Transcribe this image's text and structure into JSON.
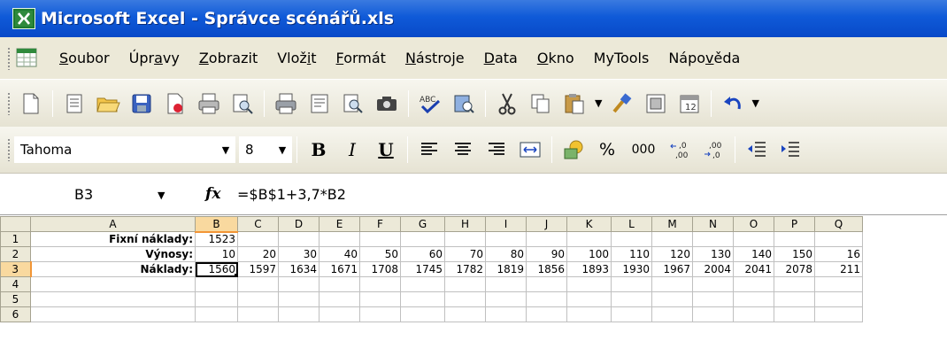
{
  "window": {
    "title": "Microsoft Excel - Správce scénářů.xls"
  },
  "menu": [
    {
      "before": "",
      "u": "S",
      "after": "oubor"
    },
    {
      "before": "Úpr",
      "u": "a",
      "after": "vy"
    },
    {
      "before": "",
      "u": "Z",
      "after": "obrazit"
    },
    {
      "before": "Vlož",
      "u": "i",
      "after": "t"
    },
    {
      "before": "",
      "u": "F",
      "after": "ormát"
    },
    {
      "before": "",
      "u": "N",
      "after": "ástroje"
    },
    {
      "before": "",
      "u": "D",
      "after": "ata"
    },
    {
      "before": "",
      "u": "O",
      "after": "kno"
    },
    {
      "before": "MyTools",
      "u": "",
      "after": ""
    },
    {
      "before": "Nápo",
      "u": "v",
      "after": "ěda"
    }
  ],
  "format_toolbar": {
    "font": "Tahoma",
    "size": "8",
    "bold": "B",
    "italic": "I",
    "underline": "U",
    "percent": "%",
    "thousands": "000",
    "inc_decimal": "⁺⁰,₀₀",
    "dec_decimal": ",₀₀→,₀"
  },
  "formula_bar": {
    "cell_ref": "B3",
    "fx": "fx",
    "formula": "=$B$1+3,7*B2"
  },
  "sheet": {
    "columns": [
      "A",
      "B",
      "C",
      "D",
      "E",
      "F",
      "G",
      "H",
      "I",
      "J",
      "K",
      "L",
      "M",
      "N",
      "O",
      "P",
      "Q"
    ],
    "selected_column": "B",
    "selected_row": "3",
    "rows": [
      {
        "num": "1",
        "label": "Fixní náklady:",
        "cells": [
          "1523",
          "",
          "",
          "",
          "",
          "",
          "",
          "",
          "",
          "",
          "",
          "",
          "",
          "",
          "",
          ""
        ]
      },
      {
        "num": "2",
        "label": "Výnosy:",
        "cells": [
          "10",
          "20",
          "30",
          "40",
          "50",
          "60",
          "70",
          "80",
          "90",
          "100",
          "110",
          "120",
          "130",
          "140",
          "150",
          "16"
        ]
      },
      {
        "num": "3",
        "label": "Náklady:",
        "cells": [
          "1560",
          "1597",
          "1634",
          "1671",
          "1708",
          "1745",
          "1782",
          "1819",
          "1856",
          "1893",
          "1930",
          "1967",
          "2004",
          "2041",
          "2078",
          "211"
        ]
      },
      {
        "num": "4",
        "label": "",
        "cells": [
          "",
          "",
          "",
          "",
          "",
          "",
          "",
          "",
          "",
          "",
          "",
          "",
          "",
          "",
          "",
          ""
        ]
      },
      {
        "num": "5",
        "label": "",
        "cells": [
          "",
          "",
          "",
          "",
          "",
          "",
          "",
          "",
          "",
          "",
          "",
          "",
          "",
          "",
          "",
          ""
        ]
      },
      {
        "num": "6",
        "label": "",
        "cells": [
          "",
          "",
          "",
          "",
          "",
          "",
          "",
          "",
          "",
          "",
          "",
          "",
          "",
          "",
          "",
          ""
        ]
      }
    ]
  },
  "colors": {
    "title_bar": "#0f5ad8",
    "toolbar_bg": "#ece9d8",
    "selected_header": "#f9d99f",
    "selection_border": "#f29536"
  }
}
